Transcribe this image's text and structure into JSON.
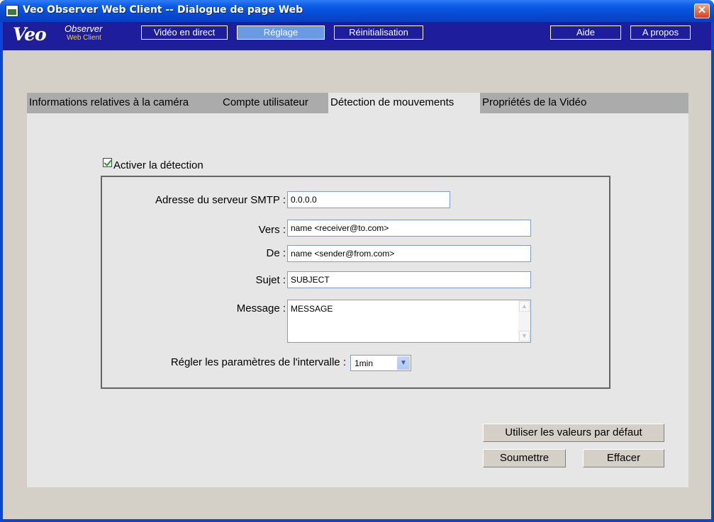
{
  "window": {
    "title": "Veo Observer Web Client -- Dialogue de page Web",
    "close_glyph": "✕"
  },
  "logo": {
    "veo": "Veo",
    "observer": "Observer",
    "web_client": "Web Client"
  },
  "nav": {
    "live_video": "Vidéo en direct",
    "settings": "Réglage",
    "reset": "Réinitialisation",
    "help": "Aide",
    "about": "A propos",
    "active_item": "Réglage"
  },
  "tabs": [
    {
      "label": "Informations relatives à la caméra",
      "active": false
    },
    {
      "label": "Compte utilisateur",
      "active": false
    },
    {
      "label": "Détection de mouvements",
      "active": true
    },
    {
      "label": "Propriétés de la Vidéo",
      "active": false
    }
  ],
  "form": {
    "enable_detection_label": "Activer la détection",
    "enable_detection_checked": true,
    "smtp_label": "Adresse du serveur SMTP :",
    "smtp_value": "0.0.0.0",
    "to_label": "Vers :",
    "to_value": "name <receiver@to.com>",
    "from_label": "De :",
    "from_value": "name <sender@from.com>",
    "subject_label": "Sujet :",
    "subject_value": "SUBJECT",
    "message_label": "Message :",
    "message_value": "MESSAGE",
    "interval_label": "Régler les paramètres de l'intervalle :",
    "interval_value": "1min"
  },
  "buttons": {
    "use_defaults": "Utiliser les valeurs par défaut",
    "submit": "Soumettre",
    "clear": "Effacer"
  },
  "icons": {
    "close": "close-icon",
    "scroll_up": "chevron-up-icon",
    "scroll_down": "chevron-down-icon",
    "dropdown": "chevron-down-icon"
  },
  "colors": {
    "titlebar": "#0a5ae6",
    "navbar": "#1e1e9c",
    "active_nav": "#6a9ae6",
    "panel": "#e6e6e6",
    "tabbar": "#ababab",
    "logo_accent": "#ffd400",
    "checkmark": "#21a121"
  }
}
